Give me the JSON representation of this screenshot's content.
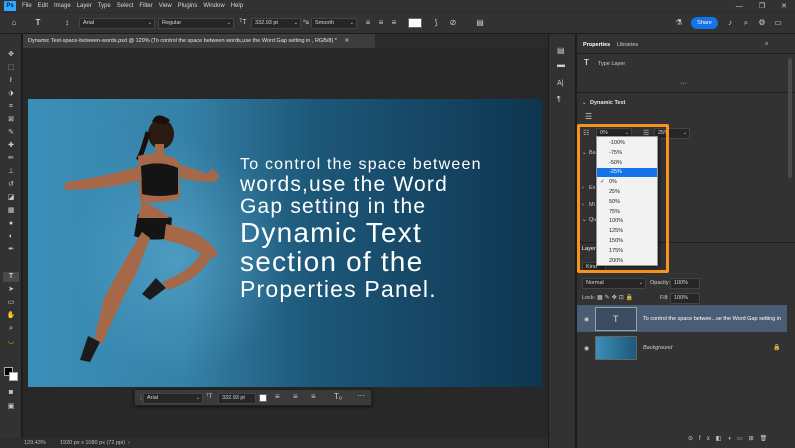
{
  "menubar": {
    "logo": "Ps",
    "items": [
      "File",
      "Edit",
      "Image",
      "Layer",
      "Type",
      "Select",
      "Filter",
      "View",
      "Plugins",
      "Window",
      "Help"
    ],
    "window_controls": [
      "—",
      "❐",
      "✕"
    ]
  },
  "options": {
    "font_family": "Arial",
    "font_style": "Regular",
    "font_size": "332.93 pt",
    "antialias": "Smooth",
    "share_label": "Share"
  },
  "document": {
    "tab_title": "Dynamic Text-space-between-words.psd @ 129% (To control the space between words,use the Word Gap setting in , RGB/8) *"
  },
  "canvas": {
    "caption_lines": [
      "To control the space between",
      "words,use the Word",
      "Gap setting in the",
      "Dynamic Text",
      "section of the",
      "Properties Panel."
    ]
  },
  "context_bar": {
    "font_family": "Arial",
    "font_size": "332.93 pt"
  },
  "status": {
    "zoom": "129.43%",
    "doc_size": "1920 px x 1080 px (72 ppi)"
  },
  "panel": {
    "tabs": [
      "Properties",
      "Libraries"
    ],
    "type_layer_label": "Type Layer",
    "section_dynamic_text": "Dynamic Text",
    "word_gap_value": "0%",
    "letter_gap_value": "25%",
    "collapsed_letters": [
      "Ba",
      "Ex",
      "Mi",
      "Qu"
    ],
    "layers_label": "Layers",
    "kind_label": "Kind",
    "blend_mode": "Normal",
    "opacity_label": "Opacity:",
    "opacity_value": "100%",
    "lock_label": "Lock:",
    "fill_label": "Fill:",
    "fill_value": "100%"
  },
  "dropdown": {
    "options": [
      "-100%",
      "-75%",
      "-50%",
      "-25%",
      "0%",
      "25%",
      "50%",
      "75%",
      "100%",
      "125%",
      "150%",
      "175%",
      "200%"
    ],
    "highlighted": "-25%",
    "checked": "0%"
  },
  "layers": [
    {
      "name": "To control the space betwee...se the Word Gap setting in",
      "type": "text"
    },
    {
      "name": "Background",
      "type": "image"
    }
  ],
  "icons": {
    "home": "⌂",
    "type_tool": "T",
    "bold_t": "T",
    "warp": "⟆",
    "cancel": "⊘",
    "commit": "✓",
    "panels": "▤",
    "search": "🔍",
    "bell": "🔔",
    "gear": "⚙",
    "help": "?",
    "cloud": "☁"
  },
  "colors": {
    "accent_blue": "#1473e6",
    "highlight_orange": "#f7941d",
    "panel_bg": "#323232"
  }
}
